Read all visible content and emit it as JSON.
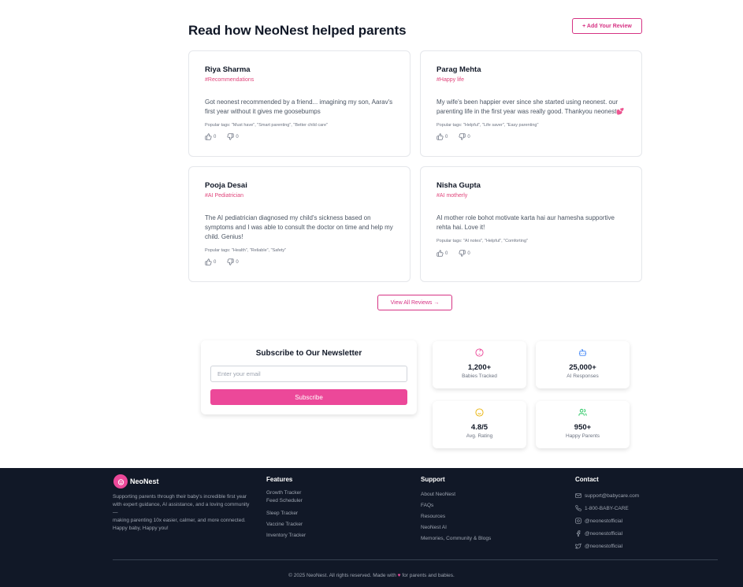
{
  "section": {
    "title": "Read how NeoNest helped parents",
    "add_review_label": "+ Add Your Review",
    "view_all_label": "View All Reviews →"
  },
  "reviews": [
    {
      "name": "Riya Sharma",
      "tag": "#Recommendations",
      "text": "Got neonest recommended by a friend... imagining my son, Aarav's first year without it gives me goosebumps",
      "popular_tags": "Popular tags: \"Must have\", \"Smart parenting\", \"Better child care\"",
      "likes": "0",
      "dislikes": "0"
    },
    {
      "name": "Parag Mehta",
      "tag": "#Happy life",
      "text": "My wife's been happier ever since she started using neonest. our parenting life in the first year was really good. Thankyou neonest💕",
      "popular_tags": "Popular tags: \"Helpful\", \"Life saver\", \"Easy parenting\"",
      "likes": "0",
      "dislikes": "0"
    },
    {
      "name": "Pooja Desai",
      "tag": "#AI Pediatrician",
      "text": "The AI pediatrician diagnosed my child's sickness based on symptoms and I was able to consult the doctor on time and help my child. Genius!",
      "popular_tags": "Popular tags: \"Health\", \"Reliable\", \"Safety\"",
      "likes": "0",
      "dislikes": "0"
    },
    {
      "name": "Nisha Gupta",
      "tag": "#AI motherly",
      "text": "AI mother role bohot motivate karta hai aur hamesha supportive rehta hai. Love it!",
      "popular_tags": "Popular tags: \"AI notes\", \"Helpful\", \"Comforting\"",
      "likes": "0",
      "dislikes": "0"
    }
  ],
  "newsletter": {
    "title": "Subscribe to Our Newsletter",
    "placeholder": "Enter your email",
    "button_label": "Subscribe"
  },
  "stats": [
    {
      "icon": "baby-icon",
      "value": "1,200+",
      "label": "Babies Tracked",
      "color": "#ec4899"
    },
    {
      "icon": "bot-icon",
      "value": "25,000+",
      "label": "AI Responses",
      "color": "#3b82f6"
    },
    {
      "icon": "smile-icon",
      "value": "4.8/5",
      "label": "Avg. Rating",
      "color": "#eab308"
    },
    {
      "icon": "users-icon",
      "value": "950+",
      "label": "Happy Parents",
      "color": "#22c55e"
    }
  ],
  "footer": {
    "brand": "NeoNest",
    "desc_line1": "Supporting parents through their baby's incredible first year with expert guidance, AI assistance, and a loving community—",
    "desc_line2": "making parenting 10x easier, calmer, and more connected.",
    "desc_line3": "Happy baby, Happy you!",
    "features_title": "Features",
    "features": [
      "Growth Tracker",
      "Feed Scheduler",
      "Sleep Tracker",
      "Vaccine Tracker",
      "Inventory Tracker"
    ],
    "support_title": "Support",
    "support": [
      "About NeoNest",
      "FAQs",
      "Resources",
      "NeoNest AI",
      "Memories, Community & Blogs"
    ],
    "contact_title": "Contact",
    "contact": [
      {
        "icon": "mail-icon",
        "text": "support@babycare.com"
      },
      {
        "icon": "phone-icon",
        "text": "1-800-BABY-CARE"
      },
      {
        "icon": "instagram-icon",
        "text": "@neonestofficial"
      },
      {
        "icon": "facebook-icon",
        "text": "@neonestofficial"
      },
      {
        "icon": "twitter-icon",
        "text": "@neonestofficial"
      }
    ],
    "copyright_pre": "© 2025 NeoNest. All rights reserved. Made with",
    "copyright_heart": "♥",
    "copyright_post": "for parents and babies."
  },
  "colors": {
    "accent": "#ec4899",
    "accent_text": "#d63384",
    "footer_bg": "#111827"
  }
}
